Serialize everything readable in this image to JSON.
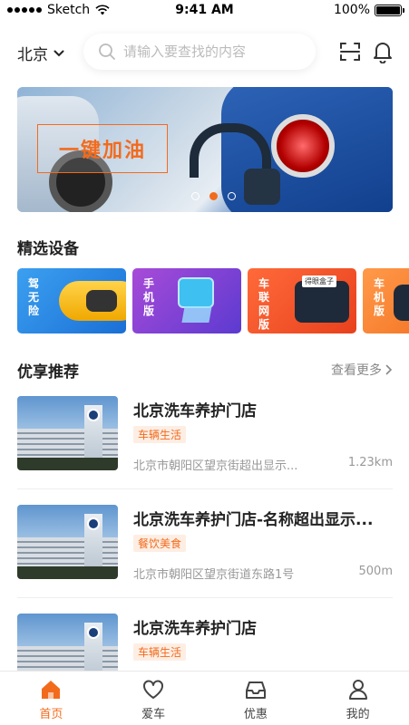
{
  "status_bar": {
    "carrier": "Sketch",
    "time": "9:41 AM",
    "battery": "100%"
  },
  "header": {
    "city": "北京",
    "search_placeholder": "请输入要查找的内容"
  },
  "banner": {
    "label": "一键加油",
    "slide_count": 3,
    "active_slide": 2
  },
  "devices_section": {
    "title": "精选设备",
    "items": [
      {
        "label": "驾无险"
      },
      {
        "label": "手机版"
      },
      {
        "label": "车联网版",
        "badge": "得眼盒子"
      },
      {
        "label": "车机版"
      }
    ]
  },
  "recommend_section": {
    "title": "优享推荐",
    "more": "查看更多",
    "items": [
      {
        "name": "北京洗车养护门店",
        "tag": "车辆生活",
        "address": "北京市朝阳区望京街超出显示...",
        "distance": "1.23km"
      },
      {
        "name": "北京洗车养护门店-名称超出显示...",
        "tag": "餐饮美食",
        "address": "北京市朝阳区望京街道东路1号",
        "distance": "500m"
      },
      {
        "name": "北京洗车养护门店",
        "tag": "车辆生活",
        "address": "",
        "distance": ""
      }
    ]
  },
  "tabbar": {
    "tabs": [
      {
        "label": "首页",
        "icon": "home-icon",
        "active": true
      },
      {
        "label": "爱车",
        "icon": "heart-icon",
        "active": false
      },
      {
        "label": "优惠",
        "icon": "inbox-icon",
        "active": false
      },
      {
        "label": "我的",
        "icon": "user-icon",
        "active": false
      }
    ]
  },
  "colors": {
    "accent": "#f26b1d",
    "text": "#222222",
    "muted": "#999999"
  }
}
